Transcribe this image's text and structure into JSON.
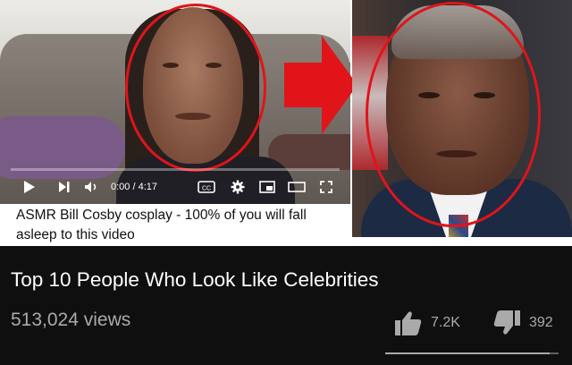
{
  "thumbnail": {
    "left_video": {
      "time_display": "0:00 / 4:17",
      "progress_fraction": 0.0,
      "caption": "ASMR Bill Cosby cosplay - 100% of you will fall asleep to this video",
      "controls": {
        "play_icon": "play-icon",
        "next_icon": "next-icon",
        "volume_icon": "volume-icon",
        "cc_icon": "cc-icon",
        "settings_icon": "gear-icon",
        "miniplayer_icon": "miniplayer-icon",
        "theater_icon": "theater-icon",
        "fullscreen_icon": "fullscreen-icon"
      }
    },
    "arrow_color": "#e1141a",
    "ellipse_color": "#e1141a"
  },
  "video": {
    "title": "Top 10 People Who Look Like Celebrities",
    "views": "513,024 views",
    "likes": "7.2K",
    "dislikes": "392",
    "like_fraction": 0.948
  },
  "colors": {
    "background": "#0f0f0f",
    "title_text": "#ffffff",
    "secondary_text": "#aaaaaa"
  }
}
